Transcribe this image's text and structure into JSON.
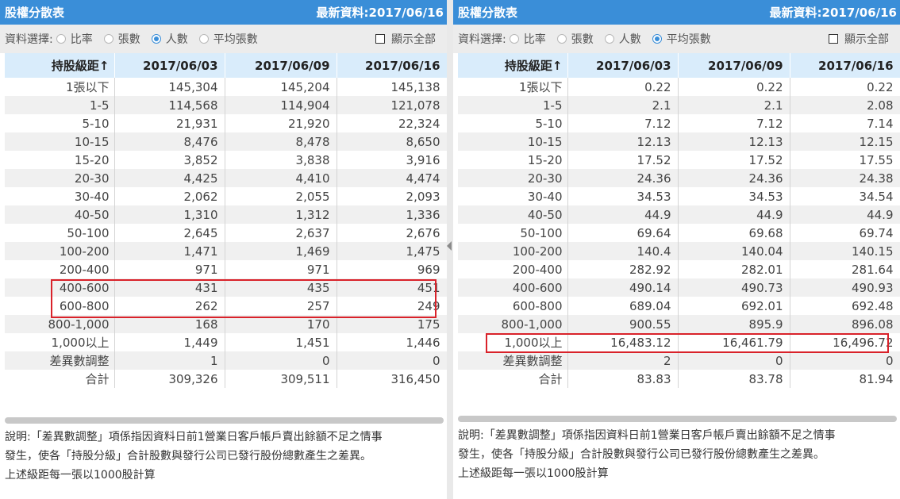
{
  "panels": [
    {
      "title": "股權分散表",
      "latest": "最新資料:2017/06/16",
      "filter": {
        "label": "資料選擇:",
        "options": [
          "比率",
          "張數",
          "人數",
          "平均張數"
        ],
        "selected": "人數",
        "show_all_label": "顯示全部"
      },
      "columns": [
        "持股級距↑",
        "2017/06/03",
        "2017/06/09",
        "2017/06/16"
      ],
      "rows": [
        [
          "1張以下",
          "145,304",
          "145,204",
          "145,138"
        ],
        [
          "1-5",
          "114,568",
          "114,904",
          "121,078"
        ],
        [
          "5-10",
          "21,931",
          "21,920",
          "22,324"
        ],
        [
          "10-15",
          "8,476",
          "8,478",
          "8,650"
        ],
        [
          "15-20",
          "3,852",
          "3,838",
          "3,916"
        ],
        [
          "20-30",
          "4,425",
          "4,410",
          "4,474"
        ],
        [
          "30-40",
          "2,062",
          "2,055",
          "2,093"
        ],
        [
          "40-50",
          "1,310",
          "1,312",
          "1,336"
        ],
        [
          "50-100",
          "2,645",
          "2,637",
          "2,676"
        ],
        [
          "100-200",
          "1,471",
          "1,469",
          "1,475"
        ],
        [
          "200-400",
          "971",
          "971",
          "969"
        ],
        [
          "400-600",
          "431",
          "435",
          "451"
        ],
        [
          "600-800",
          "262",
          "257",
          "249"
        ],
        [
          "800-1,000",
          "168",
          "170",
          "175"
        ],
        [
          "1,000以上",
          "1,449",
          "1,451",
          "1,446"
        ],
        [
          "差異數調整",
          "1",
          "0",
          "0"
        ],
        [
          "合計",
          "309,326",
          "309,511",
          "316,450"
        ]
      ],
      "notes": [
        "說明:「差異數調整」項係指因資料日前1營業日客戶帳戶賣出餘額不足之情事",
        "發生，使各「持股分級」合計股數與發行公司已發行股份總數產生之差異。",
        "上述級距每一張以1000股計算"
      ]
    },
    {
      "title": "股權分散表",
      "latest": "最新資料:2017/06/16",
      "filter": {
        "label": "資料選擇:",
        "options": [
          "比率",
          "張數",
          "人數",
          "平均張數"
        ],
        "selected": "平均張數",
        "show_all_label": "顯示全部"
      },
      "columns": [
        "持股級距↑",
        "2017/06/03",
        "2017/06/09",
        "2017/06/16"
      ],
      "rows": [
        [
          "1張以下",
          "0.22",
          "0.22",
          "0.22"
        ],
        [
          "1-5",
          "2.1",
          "2.1",
          "2.08"
        ],
        [
          "5-10",
          "7.12",
          "7.12",
          "7.14"
        ],
        [
          "10-15",
          "12.13",
          "12.13",
          "12.15"
        ],
        [
          "15-20",
          "17.52",
          "17.52",
          "17.55"
        ],
        [
          "20-30",
          "24.36",
          "24.36",
          "24.38"
        ],
        [
          "30-40",
          "34.53",
          "34.53",
          "34.54"
        ],
        [
          "40-50",
          "44.9",
          "44.9",
          "44.9"
        ],
        [
          "50-100",
          "69.64",
          "69.68",
          "69.74"
        ],
        [
          "100-200",
          "140.4",
          "140.04",
          "140.15"
        ],
        [
          "200-400",
          "282.92",
          "282.01",
          "281.64"
        ],
        [
          "400-600",
          "490.14",
          "490.73",
          "490.93"
        ],
        [
          "600-800",
          "689.04",
          "692.01",
          "692.48"
        ],
        [
          "800-1,000",
          "900.55",
          "895.9",
          "896.08"
        ],
        [
          "1,000以上",
          "16,483.12",
          "16,461.79",
          "16,496.72"
        ],
        [
          "差異數調整",
          "2",
          "0",
          "0"
        ],
        [
          "合計",
          "83.83",
          "83.78",
          "81.94"
        ]
      ],
      "notes": [
        "說明:「差異數調整」項係指因資料日前1營業日客戶帳戶賣出餘額不足之情事",
        "發生，使各「持股分級」合計股數與發行公司已發行股份總數產生之差異。",
        "上述級距每一張以1000股計算"
      ]
    }
  ]
}
